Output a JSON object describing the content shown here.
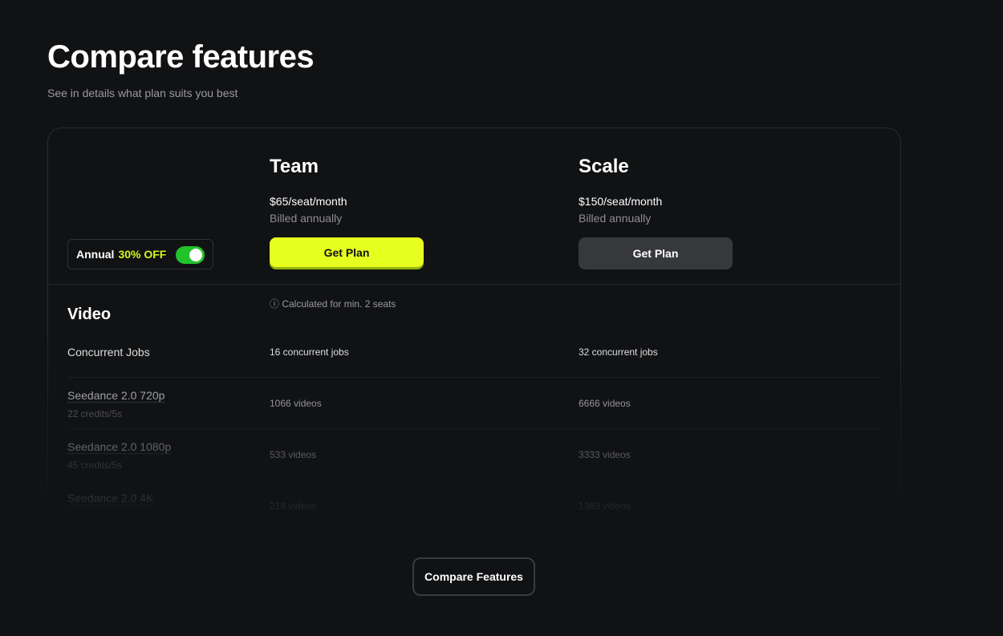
{
  "header": {
    "title": "Compare features",
    "subtitle": "See in details what plan suits you best"
  },
  "billing_toggle": {
    "label": "Annual",
    "discount": "30% OFF",
    "enabled": true,
    "accent_color": "#22c22a"
  },
  "plans": [
    {
      "name": "Team",
      "price": "$65/seat/month",
      "billing": "Billed annually",
      "button_label": "Get Plan",
      "button_color": "#e6ff1f",
      "note": "ⓘ Calculated for min. 2 seats"
    },
    {
      "name": "Scale",
      "price": "$150/seat/month",
      "billing": "Billed annually",
      "button_label": "Get Plan",
      "button_color": "#37383c"
    }
  ],
  "sections": [
    {
      "title": "Video",
      "rows": [
        {
          "feature": "Concurrent Jobs",
          "sub": "",
          "team": "16 concurrent jobs",
          "scale": "32 concurrent jobs"
        },
        {
          "feature": "Seedance 2.0 720p",
          "sub": "22 credits/5s",
          "team": "1066 videos",
          "scale": "6666 videos"
        },
        {
          "feature": "Seedance 2.0 1080p",
          "sub": "45 credits/5s",
          "team": "533 videos",
          "scale": "3333 videos"
        },
        {
          "feature": "Seedance 2.0 4K",
          "sub": "",
          "team": "218 videos",
          "scale": "1363 videos"
        }
      ]
    }
  ],
  "footer": {
    "compare_button_label": "Compare Features"
  }
}
